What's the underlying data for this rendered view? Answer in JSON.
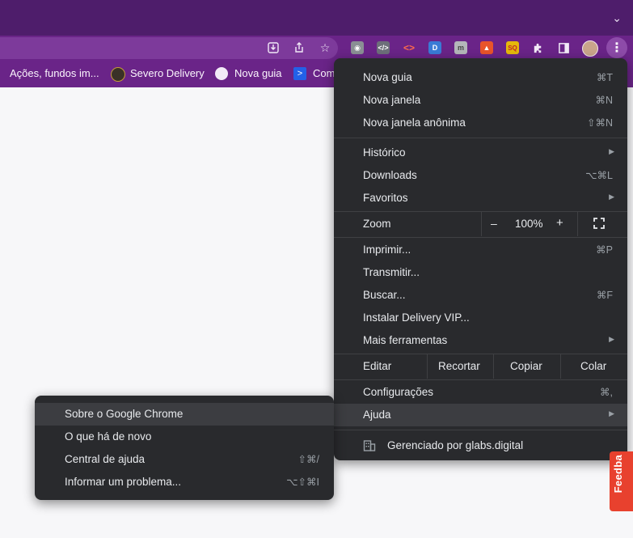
{
  "bookmarks": [
    {
      "label": "Ações, fundos im..."
    },
    {
      "label": "Severo Delivery"
    },
    {
      "label": "Nova guia"
    },
    {
      "label": "Com"
    }
  ],
  "menu": {
    "items": [
      {
        "label": "Nova guia",
        "shortcut": "⌘T"
      },
      {
        "label": "Nova janela",
        "shortcut": "⌘N"
      },
      {
        "label": "Nova janela anônima",
        "shortcut": "⇧⌘N"
      },
      {
        "label": "Histórico"
      },
      {
        "label": "Downloads",
        "shortcut": "⌥⌘L"
      },
      {
        "label": "Favoritos"
      },
      {
        "label": "Imprimir...",
        "shortcut": "⌘P"
      },
      {
        "label": "Transmitir..."
      },
      {
        "label": "Buscar...",
        "shortcut": "⌘F"
      },
      {
        "label": "Instalar Delivery VIP..."
      },
      {
        "label": "Mais ferramentas"
      },
      {
        "label": "Configurações",
        "shortcut": "⌘,"
      },
      {
        "label": "Ajuda"
      }
    ],
    "zoom": {
      "label": "Zoom",
      "minus": "–",
      "value": "100%",
      "plus": "+"
    },
    "edit": {
      "label": "Editar",
      "cut": "Recortar",
      "copy": "Copiar",
      "paste": "Colar"
    },
    "managed": "Gerenciado por glabs.digital"
  },
  "submenu": {
    "items": [
      {
        "label": "Sobre o Google Chrome"
      },
      {
        "label": "O que há de novo"
      },
      {
        "label": "Central de ajuda",
        "shortcut": "⇧⌘/"
      },
      {
        "label": "Informar um problema...",
        "shortcut": "⌥⇧⌘I"
      }
    ]
  },
  "feedback": "Feedba",
  "colors": {
    "frame": "#4e1d6b",
    "toolbar": "#6a2488",
    "menu_bg": "#292a2d",
    "highlight": "#3c3d41",
    "feedback": "#e8412e"
  }
}
